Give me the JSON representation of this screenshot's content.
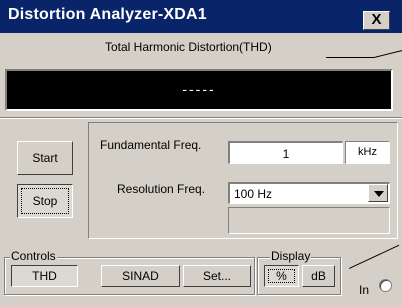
{
  "window": {
    "title": "Distortion Analyzer-XDA1",
    "close_label": "X"
  },
  "display": {
    "label": "Total Harmonic Distortion(THD)",
    "value": "-----"
  },
  "buttons": {
    "start": "Start",
    "stop": "Stop"
  },
  "fundamental": {
    "label": "Fundamental Freq.",
    "value": "1",
    "unit": "kHz"
  },
  "resolution": {
    "label": "Resolution Freq.",
    "selected": "100 Hz"
  },
  "controls": {
    "title": "Controls",
    "thd": "THD",
    "sinad": "SINAD",
    "set": "Set..."
  },
  "display_group": {
    "title": "Display",
    "percent": "%",
    "db": "dB"
  },
  "input": {
    "label": "In"
  }
}
